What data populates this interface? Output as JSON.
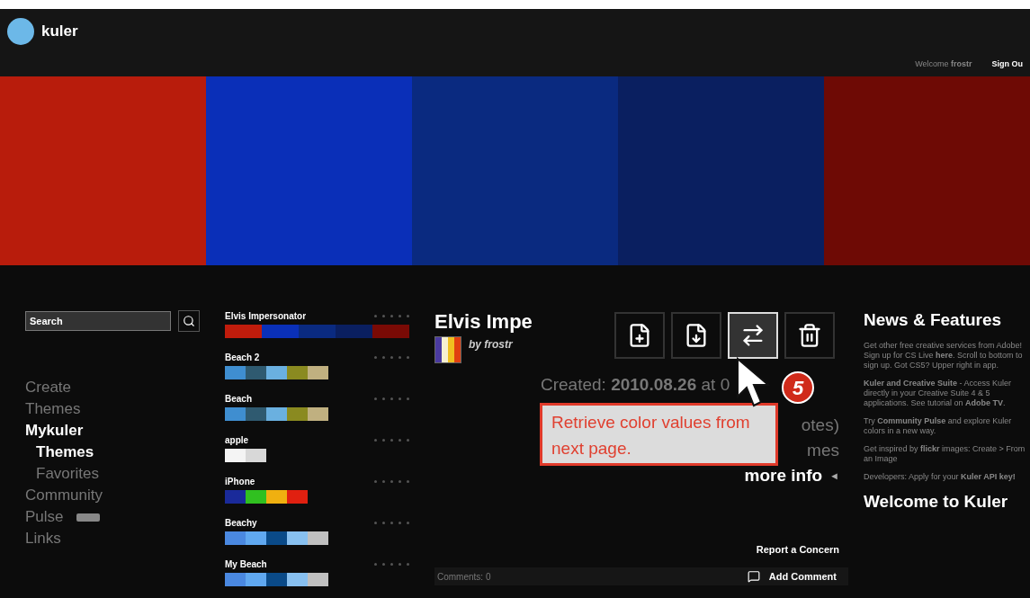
{
  "header": {
    "logo": "kuler",
    "welcome": "Welcome **frostr**",
    "sign_out": "Sign Ou"
  },
  "banner": {
    "swatches": [
      {
        "color": "#b81c0c"
      },
      {
        "color": "#0a2fb8"
      },
      {
        "color": "#0a2a80"
      },
      {
        "color": "#0a1f60"
      },
      {
        "color": "#6e0a05"
      }
    ]
  },
  "sidebar": {
    "search": {
      "placeholder": "Search"
    },
    "items": [
      {
        "label": "Create",
        "selected": false,
        "badge": false
      },
      {
        "label": "Themes",
        "selected": false,
        "badge": false
      },
      {
        "label": "Mykuler",
        "selected": true,
        "badge": false,
        "children": [
          {
            "label": "Themes",
            "selected": true
          },
          {
            "label": "Favorites",
            "selected": false
          }
        ]
      },
      {
        "label": "Community",
        "selected": false,
        "badge": false
      },
      {
        "label": "Pulse",
        "selected": false,
        "badge": true
      },
      {
        "label": "Links",
        "selected": false,
        "badge": false
      }
    ]
  },
  "themes": [
    {
      "name": "Elvis Impersonator",
      "stars": 0,
      "wide": true,
      "swatches": [
        {
          "color": "#c01c0c"
        },
        {
          "color": "#0a30b8"
        },
        {
          "color": "#0a2a80"
        },
        {
          "color": "#0a1f60"
        },
        {
          "color": "#7a0a05"
        }
      ]
    },
    {
      "name": "Beach 2",
      "stars": 0,
      "wide": false,
      "swatches": [
        {
          "color": "#3f8ed0"
        },
        {
          "color": "#2f5a70"
        },
        {
          "color": "#6ab0e0"
        },
        {
          "color": "#8a8a20"
        },
        {
          "color": "#c0b080"
        }
      ]
    },
    {
      "name": "Beach",
      "stars": 0,
      "wide": false,
      "swatches": [
        {
          "color": "#3f8ed0"
        },
        {
          "color": "#2f5a70"
        },
        {
          "color": "#6ab0e0"
        },
        {
          "color": "#8a8a20"
        },
        {
          "color": "#c0b080"
        }
      ]
    },
    {
      "name": "apple",
      "stars": 0,
      "wide": false,
      "swatches": [
        {
          "color": "#f4f4f4"
        },
        {
          "color": "#d8d8d8"
        }
      ]
    },
    {
      "name": "iPhone",
      "stars": 0,
      "wide": false,
      "swatches": [
        {
          "color": "#1a2a9a"
        },
        {
          "color": "#30c020"
        },
        {
          "color": "#f0b010"
        },
        {
          "color": "#e02010"
        }
      ]
    },
    {
      "name": "Beachy",
      "stars": 0,
      "wide": false,
      "swatches": [
        {
          "color": "#4a88e0"
        },
        {
          "color": "#60a8f0"
        },
        {
          "color": "#0a4a88"
        },
        {
          "color": "#88c0f0"
        },
        {
          "color": "#c0c0c0"
        }
      ]
    },
    {
      "name": "My Beach",
      "stars": 0,
      "wide": false,
      "swatches": [
        {
          "color": "#4a88e0"
        },
        {
          "color": "#60a8f0"
        },
        {
          "color": "#0a4a88"
        },
        {
          "color": "#88c0f0"
        },
        {
          "color": "#c0c0c0"
        }
      ]
    }
  ],
  "detail": {
    "title": "Elvis Impe",
    "author": "by frostr",
    "thumbnail": [
      {
        "color": "#4a3aa0"
      },
      {
        "color": "#f6f0d0"
      },
      {
        "color": "#f0c020"
      },
      {
        "color": "#e04010"
      }
    ],
    "tools": [
      {
        "kind": "add",
        "selected": false
      },
      {
        "kind": "download",
        "selected": false
      },
      {
        "kind": "swap",
        "selected": true
      },
      {
        "kind": "delete",
        "selected": false
      }
    ],
    "created": "Created: **2010.08.26** at 0",
    "fragments": [
      "otes)",
      "mes"
    ],
    "more_info": "more info",
    "more_arrow": "◄",
    "report": "Report a Concern",
    "comments": "Comments: 0",
    "add_comment": "Add Comment"
  },
  "annotation": {
    "text": "Retrieve color values from next page.",
    "step": "5"
  },
  "news": {
    "title": "News & Features",
    "paragraphs": [
      "Get other free creative services from Adobe! Sign up for CS Live **here**. Scroll to bottom to sign up. Got CS5? Upper right in app.",
      "**Kuler and Creative Suite** - Access Kuler directly in your Creative Suite 4 & 5 applications. See tutorial on **Adobe TV**.",
      "Try **Community Pulse** and explore Kuler colors in a new way.",
      "Get inspired by **flickr** images: Create > From an Image",
      "Developers: Apply for your **Kuler API key!**"
    ],
    "welcome": "Welcome to Kuler"
  }
}
